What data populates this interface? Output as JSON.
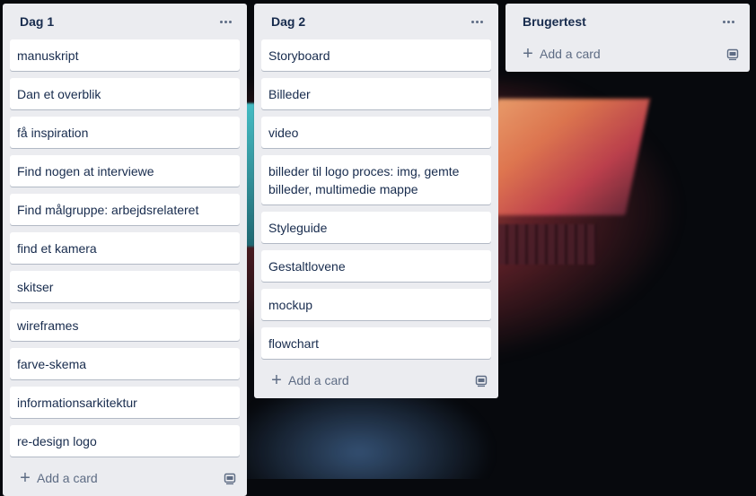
{
  "board": {
    "lists": [
      {
        "title": "Dag 1",
        "cards": [
          "manuskript",
          "Dan et overblik",
          "få inspiration",
          "Find nogen at interviewe",
          "Find målgruppe: arbejdsrelateret",
          "find et kamera",
          "skitser",
          "wireframes",
          "farve-skema",
          "informationsarkitektur",
          "re-design logo"
        ],
        "add_label": "Add a card"
      },
      {
        "title": "Dag 2",
        "cards": [
          "Storyboard",
          "Billeder",
          "video",
          "billeder til logo proces: img, gemte billeder, multimedie mappe",
          "Styleguide",
          "Gestaltlovene",
          "mockup",
          "flowchart"
        ],
        "add_label": "Add a card"
      },
      {
        "title": "Brugertest",
        "cards": [],
        "add_label": "Add a card"
      }
    ],
    "icons": {
      "list_menu": "more-horizontal-icon",
      "add": "plus-icon",
      "template": "card-template-icon"
    },
    "colors": {
      "list_bg": "#ebecf0",
      "card_bg": "#ffffff",
      "text": "#172b4d",
      "muted": "#5e6c84"
    }
  }
}
